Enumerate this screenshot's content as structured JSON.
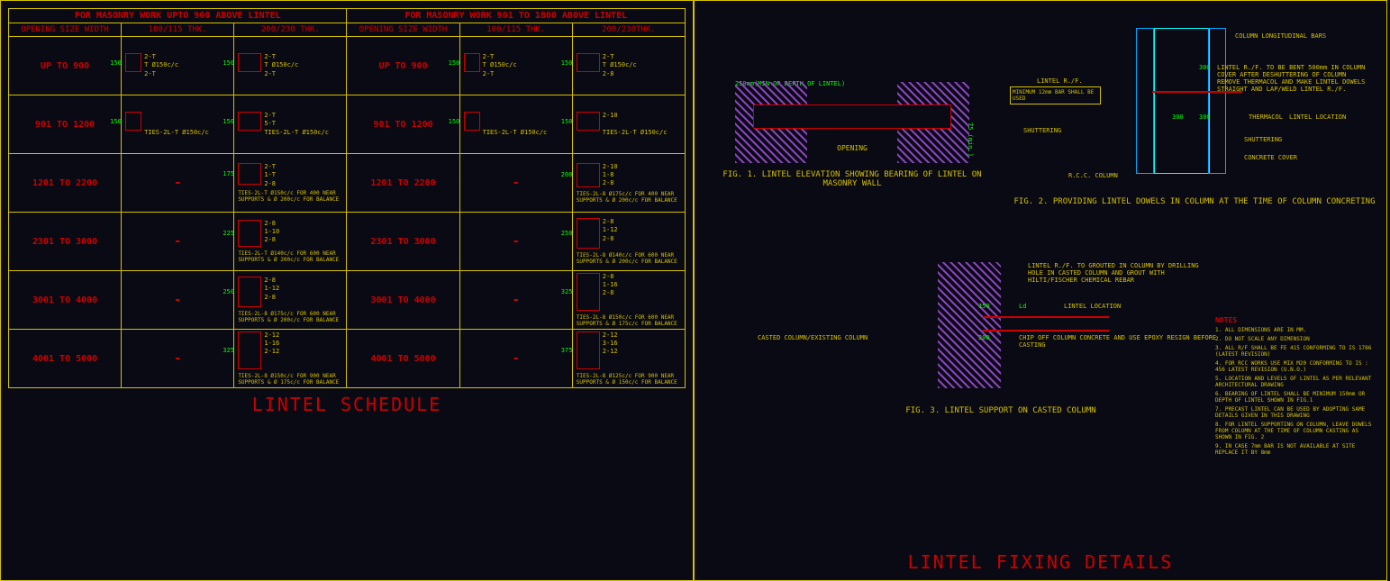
{
  "tables": {
    "left": {
      "header": "FOR  MASONRY WORK UPTO 900 ABOVE LINTEL",
      "col0": "OPENING SIZE WIDTH",
      "col1": "100/115 THK.",
      "col2": "200/230 THK."
    },
    "right": {
      "header": "FOR  MASONRY WORK 901 TO 1800 ABOVE LINTEL",
      "col0": "OPENING SIZE WIDTH",
      "col1": "100/115 THK.",
      "col2": "200/230THK."
    },
    "rows": [
      "UP TO 900",
      "901 TO 1200",
      "1201 TO 2200",
      "2301 TO 3000",
      "3001 TO 4000",
      "4001 TO 5000"
    ],
    "data": {
      "L": [
        [
          {
            "h": "150",
            "a": [
              "2-T",
              "T Ø150c/c",
              "2-T"
            ]
          },
          {
            "h": "150",
            "a": [
              "2-T",
              "T Ø150c/c",
              "2-T"
            ]
          }
        ],
        [
          {
            "h": "150",
            "a": [
              "",
              "",
              "TIES-2L-T Ø150c/c"
            ]
          },
          {
            "h": "150",
            "a": [
              "2-T",
              "5-T",
              "TIES-2L-T Ø150c/c"
            ]
          }
        ],
        [
          null,
          {
            "h": "175",
            "a": [
              "2-T",
              "1-T",
              "2-8"
            ],
            "t": "TIES-2L-T Ø150c/c FOR 400 NEAR SUPPORTS & Ø 200c/c FOR BALANCE"
          }
        ],
        [
          null,
          {
            "h": "225",
            "a": [
              "2-8",
              "1-10",
              "2-8"
            ],
            "t": "TIES-2L-T Ø140c/c FOR 600 NEAR SUPPORTS & Ø 200c/c FOR BALANCE"
          }
        ],
        [
          null,
          {
            "h": "250",
            "a": [
              "2-8",
              "1-12",
              "2-8"
            ],
            "t": "TIES-2L-8 Ø175c/c FOR 600 NEAR SUPPORTS & Ø 200c/c FOR BALANCE"
          }
        ],
        [
          null,
          {
            "h": "325",
            "a": [
              "2-12",
              "1-16",
              "2-12"
            ],
            "t": "TIES-2L-8 Ø150c/c FOR 900 NEAR SUPPORTS & Ø 175c/c FOR BALANCE"
          }
        ]
      ],
      "R": [
        [
          {
            "h": "150",
            "a": [
              "2-T",
              "T Ø150c/c",
              "2-T"
            ]
          },
          {
            "h": "150",
            "a": [
              "2-T",
              "T Ø150c/c",
              "2-8"
            ]
          }
        ],
        [
          {
            "h": "150",
            "a": [
              "",
              "",
              "TIES-2L-T Ø150c/c"
            ]
          },
          {
            "h": "150",
            "a": [
              "2-10",
              "",
              "TIES-2L-T Ø150c/c"
            ]
          }
        ],
        [
          null,
          {
            "h": "200",
            "a": [
              "2-10",
              "1-8",
              "2-8"
            ],
            "t": "TIES-2L-8 Ø175c/c FOR 400 NEAR SUPPORTS & Ø 200c/c FOR BALANCE"
          }
        ],
        [
          null,
          {
            "h": "250",
            "a": [
              "2-8",
              "1-12",
              "2-8"
            ],
            "t": "TIES-2L-8 Ø140c/c FOR 600 NEAR SUPPORTS & Ø 200c/c FOR BALANCE"
          }
        ],
        [
          null,
          {
            "h": "325",
            "a": [
              "2-8",
              "1-16",
              "2-8"
            ],
            "t": "TIES-2L-8 Ø150c/c FOR 600 NEAR SUPPORTS & Ø 175c/c FOR BALANCE"
          }
        ],
        [
          null,
          {
            "h": "375",
            "a": [
              "2-12",
              "3-16",
              "2-12"
            ],
            "t": "TIES-2L-8 Ø125c/c FOR 900 NEAR SUPPORTS & Ø 150c/c FOR BALANCE"
          }
        ]
      ]
    }
  },
  "title1": "LINTEL SCHEDULE",
  "title2": "LINTEL FIXING DETAILS",
  "fig1": {
    "dim1": "250mm(MIN OR DEPTH OF LINTEL)",
    "opening": "OPENING",
    "dim2": "75 (min.)",
    "caption": "FIG. 1.  LINTEL ELEVATION SHOWING BEARING OF LINTEL ON MASONRY WALL"
  },
  "fig2": {
    "longbars": "COLUMN LONGITUDINAL BARS",
    "lintelrf": "LINTEL R./F.",
    "minbox": "MINIMUM 12mm BAR SHALL BE USED",
    "shuttering": "SHUTTERING",
    "rcc": "R.C.C. COLUMN",
    "bent": "LINTEL R./F. TO BE BENT 500mm IN COLUMN COVER AFTER DESHUTTERING OF COLUMN REMOVE THERMACOL AND MAKE LINTEL DOWELS STRAIGHT AND LAP/WELD LINTEL R./F.",
    "thermacol": "THERMACOL",
    "lintelloc": "LINTEL LOCATION",
    "shuttering2": "SHUTTERING",
    "concrete": "CONCRETE COVER",
    "d300a": "300",
    "d300b": "300",
    "d300c": "300",
    "caption": "FIG. 2.  PROVIDING LINTEL DOWELS IN COLUMN AT THE TIME OF COLUMN CONCRETING"
  },
  "fig3": {
    "grout": "LINTEL R./F. TO GROUTED IN COLUMN BY DRILLING HOLE IN CASTED COLUMN AND GROUT WITH HILTI/FISCHER CHEMICAL REBAR",
    "lintelloc": "LINTEL LOCATION",
    "ld": "Ld",
    "d150": "150",
    "d200": "200",
    "chip": "CHIP OFF COLUMN CONCRETE AND USE EPOXY RESIGN BEFORE CASTING",
    "casted": "CASTED COLUMN/EXISTING COLUMN",
    "caption": "FIG.  3. LINTEL SUPPORT ON CASTED COLUMN"
  },
  "notes": {
    "title": "NOTES",
    "items": [
      "1. ALL DIMENSIONS ARE IN MM.",
      "2. DO NOT SCALE ANY DIMENSION",
      "3. ALL R/F SHALL BE FE 415 CONFORMING TO IS 1786 (LATEST REVISION)",
      "4. FOR RCC WORKS USE MIX M20 CONFORMING TO IS : 456 LATEST REVISION (U.N.O.)",
      "5. LOCATION AND LEVELS OF LINTEL AS PER RELEVANT ARCHITECTURAL DRAWING",
      "6. BEARING OF LINTEL SHALL BE MINIMUM 150mm OR DEPTH OF LINTEL SHOWN IN FIG.1",
      "7. PRECAST LINTEL CAN BE USED BY ADOPTING SAME DETAILS GIVEN IN THIS DRAWING",
      "8. FOR LINTEL SUPPORTING ON COLUMN, LEAVE DOWELS FROM COLUMN AT THE TIME OF COLUMN CASTING AS SHOWN IN FIG. 2",
      "9. IN CASE 7mm BAR IS NOT AVAILABLE AT SITE REPLACE IT BY 8mm"
    ]
  }
}
